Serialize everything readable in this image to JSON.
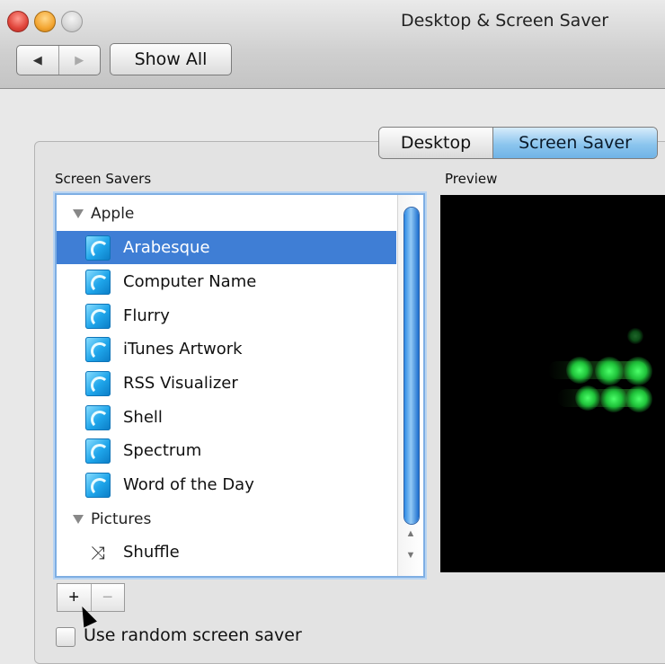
{
  "window": {
    "title": "Desktop & Screen Saver",
    "nav_back": "◀",
    "nav_forward": "▶",
    "show_all": "Show All"
  },
  "tabs": [
    {
      "label": "Desktop",
      "selected": false
    },
    {
      "label": "Screen Saver",
      "selected": true
    }
  ],
  "screen_savers": {
    "header": "Screen Savers",
    "groups": [
      {
        "label": "Apple",
        "items": [
          {
            "label": "Arabesque",
            "icon": "screensaver-icon",
            "selected": true
          },
          {
            "label": "Computer Name",
            "icon": "screensaver-icon"
          },
          {
            "label": "Flurry",
            "icon": "screensaver-icon"
          },
          {
            "label": "iTunes Artwork",
            "icon": "screensaver-icon"
          },
          {
            "label": "RSS Visualizer",
            "icon": "screensaver-icon"
          },
          {
            "label": "Shell",
            "icon": "screensaver-icon"
          },
          {
            "label": "Spectrum",
            "icon": "screensaver-icon"
          },
          {
            "label": "Word of the Day",
            "icon": "screensaver-icon"
          }
        ]
      },
      {
        "label": "Pictures",
        "items": [
          {
            "label": "Shuffle",
            "icon": "shuffle-icon"
          }
        ]
      }
    ]
  },
  "preview": {
    "header": "Preview"
  },
  "buttons": {
    "add": "+",
    "remove": "−"
  },
  "random_checkbox": {
    "label": "Use random screen saver",
    "checked": false
  },
  "colors": {
    "selection": "#3f7ed5",
    "accent_tab": "#8cc5ee",
    "preview_glow": "#4cff6a"
  }
}
